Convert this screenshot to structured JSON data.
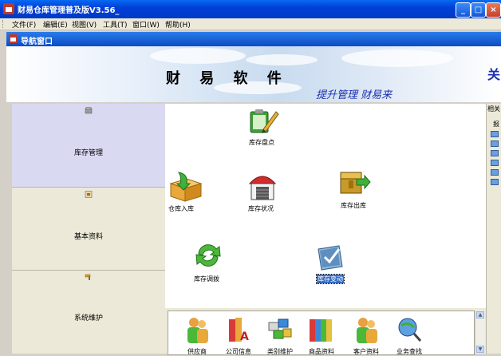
{
  "window": {
    "title": "财易仓库管理普及版V3.56_"
  },
  "menu": [
    {
      "label": "文件(F)"
    },
    {
      "label": "编辑(E)"
    },
    {
      "label": "视图(V)"
    },
    {
      "label": "工具(T)"
    },
    {
      "label": "窗口(W)"
    },
    {
      "label": "帮助(H)"
    }
  ],
  "mdi": {
    "title": "导航窗口"
  },
  "banner": {
    "brand": "财 易 软 件",
    "slogan": "提升管理  财易来",
    "right_text": "关"
  },
  "sidebar": [
    {
      "label": "库存管理",
      "icon": "box-icon",
      "active": true
    },
    {
      "label": "基本资料",
      "icon": "document-icon",
      "active": false
    },
    {
      "label": "系统维护",
      "icon": "hammer-icon",
      "active": false
    }
  ],
  "main_items": {
    "inventory_count": "库存盘点",
    "stock_in": "仓库入库",
    "stock_status": "库存状况",
    "stock_out": "库存出库",
    "transfer": "库存调拨",
    "changes": "库存变动"
  },
  "bottom_items": [
    "供应商",
    "公司信息",
    "类别维护",
    "商品资料",
    "客户资料",
    "业务查找"
  ],
  "right_panel": {
    "label": "相关",
    "label2": "报"
  },
  "colors": {
    "title_bar": "#0a4fd8",
    "selection": "#316ac5",
    "slogan": "#1b2fb0"
  }
}
